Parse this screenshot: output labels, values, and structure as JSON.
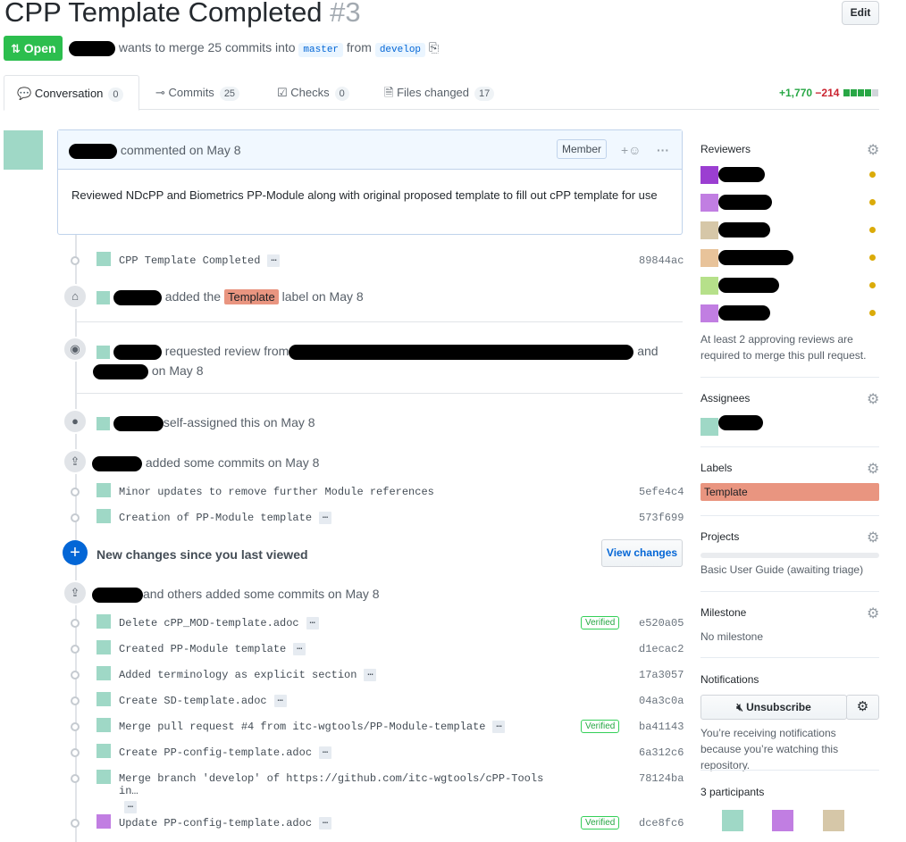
{
  "header": {
    "title": "CPP Template Completed",
    "number": "#3",
    "edit_label": "Edit",
    "state": "Open",
    "merge_text": "wants to merge 25 commits into",
    "base_branch": "master",
    "from_text": "from",
    "head_branch": "develop"
  },
  "tabs": [
    {
      "label": "Conversation",
      "count": "0"
    },
    {
      "label": "Commits",
      "count": "25"
    },
    {
      "label": "Checks",
      "count": "0"
    },
    {
      "label": "Files changed",
      "count": "17"
    }
  ],
  "diffstat": {
    "additions": "+1,770",
    "deletions": "−214",
    "green_blocks": 4,
    "gray_blocks": 1
  },
  "comment": {
    "action": "commented on May 8",
    "role": "Member",
    "body": "Reviewed NDcPP and Biometrics PP-Module along with original proposed template to fill out cPP template for use"
  },
  "events": {
    "label_added_prefix": "added the",
    "label_name": "Template",
    "label_added_suffix": "label on May 8",
    "review_requested": "requested review from",
    "review_and": "and",
    "review_date": "on May 8",
    "self_assigned": "self-assigned this on May 8",
    "added_commits": "added some commits on May 8",
    "others_added_commits": "and others added some commits on May 8",
    "new_changes": "New changes since you last viewed",
    "view_changes": "View changes"
  },
  "commits_first": [
    {
      "msg": "CPP Template Completed",
      "sha": "89844ac",
      "verified": ""
    }
  ],
  "commits_second": [
    {
      "msg": "Minor updates to remove further Module references",
      "sha": "5efe4c4",
      "verified": ""
    },
    {
      "msg": "Creation of PP-Module template",
      "sha": "573f699",
      "verified": ""
    }
  ],
  "commits_third": [
    {
      "msg": "Delete cPP_MOD-template.adoc",
      "sha": "e520a05",
      "verified": "Verified"
    },
    {
      "msg": "Created PP-Module template",
      "sha": "d1ecac2",
      "verified": ""
    },
    {
      "msg": "Added terminology as explicit section",
      "sha": "17a3057",
      "verified": ""
    },
    {
      "msg": "Create SD-template.adoc",
      "sha": "04a3c0a",
      "verified": ""
    },
    {
      "msg": "Merge pull request #4 from itc-wgtools/PP-Module-template",
      "sha": "ba41143",
      "verified": "Verified"
    },
    {
      "msg": "Create PP-config-template.adoc",
      "sha": "6a312c6",
      "verified": ""
    },
    {
      "msg": "Merge branch 'develop' of https://github.com/itc-wgtools/cPP-Tools in…",
      "sha": "78124ba",
      "verified": ""
    },
    {
      "msg": "Update PP-config-template.adoc",
      "sha": "dce8fc6",
      "verified": "Verified"
    }
  ],
  "sidebar": {
    "reviewers_title": "Reviewers",
    "reviewers_note": "At least 2 approving reviews are required to merge this pull request.",
    "assignees_title": "Assignees",
    "labels_title": "Labels",
    "label": "Template",
    "label_color": "#e99580",
    "projects_title": "Projects",
    "project_name": "Basic User Guide (awaiting triage)",
    "milestone_title": "Milestone",
    "milestone_value": "No milestone",
    "notifications_title": "Notifications",
    "unsubscribe_label": "Unsubscribe",
    "notifications_note": "You’re receiving notifications because you’re watching this repository.",
    "participants": "3 participants"
  }
}
